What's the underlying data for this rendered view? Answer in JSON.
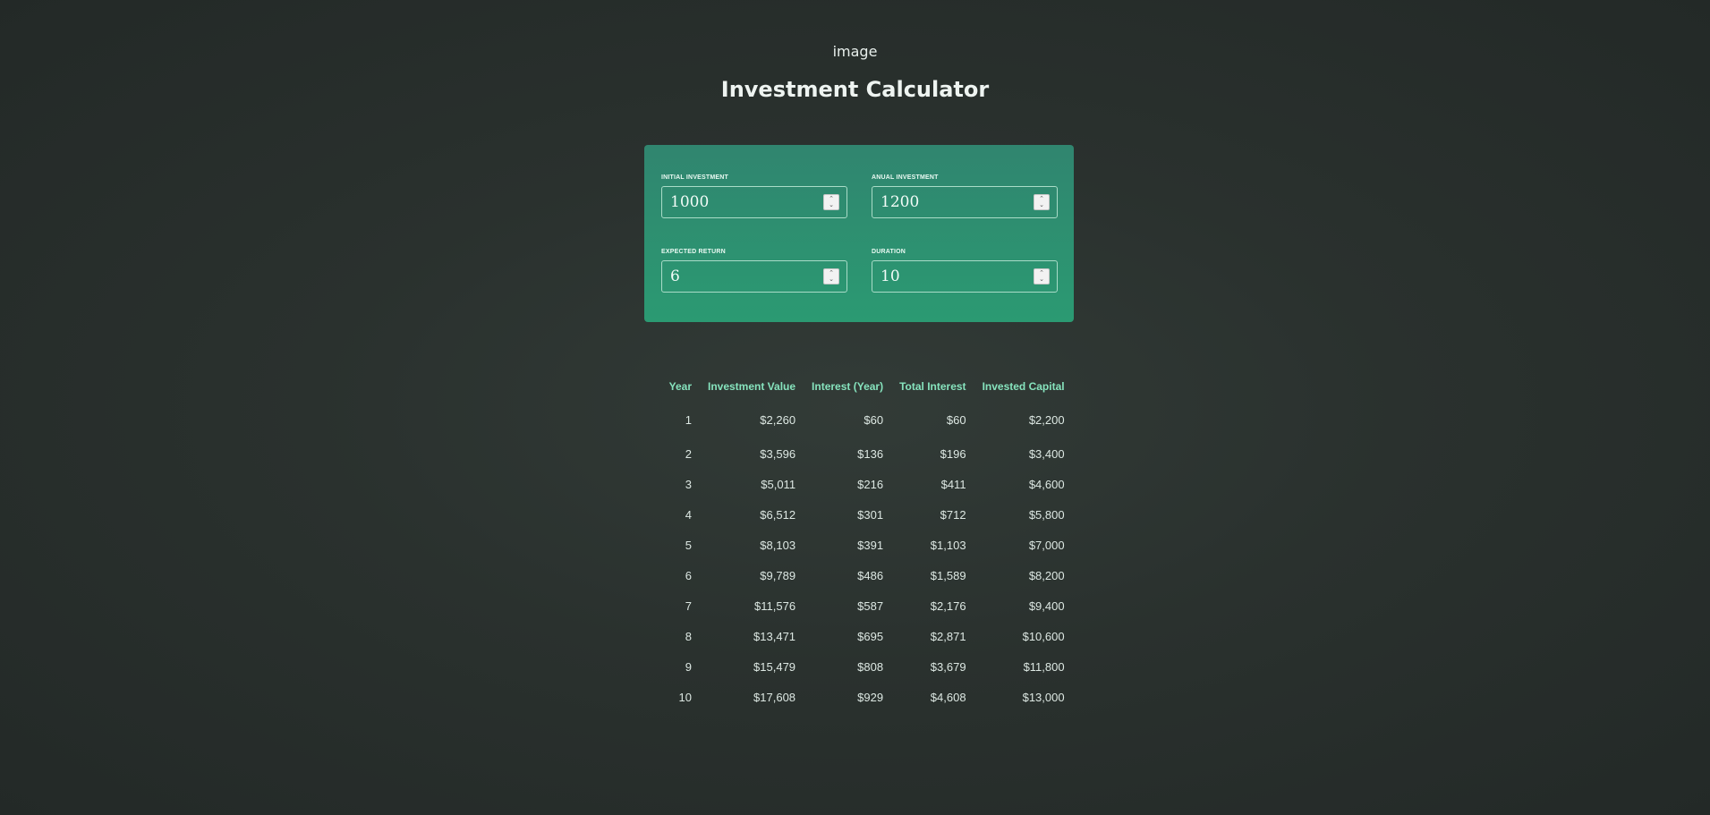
{
  "header": {
    "logo_alt_text": "image",
    "title": "Investment Calculator"
  },
  "inputs": [
    {
      "label": "INITIAL INVESTMENT",
      "value": "1000"
    },
    {
      "label": "ANUAL INVESTMENT",
      "value": "1200"
    },
    {
      "label": "EXPECTED RETURN",
      "value": "6"
    },
    {
      "label": "DURATION",
      "value": "10"
    }
  ],
  "colors": {
    "accent": "#2b9a72",
    "table_header": "#86e3bd",
    "background": "#2a312e"
  },
  "table": {
    "headers": [
      "Year",
      "Investment Value",
      "Interest (Year)",
      "Total Interest",
      "Invested Capital"
    ],
    "rows": [
      [
        "1",
        "$2,260",
        "$60",
        "$60",
        "$2,200"
      ],
      [
        "2",
        "$3,596",
        "$136",
        "$196",
        "$3,400"
      ],
      [
        "3",
        "$5,011",
        "$216",
        "$411",
        "$4,600"
      ],
      [
        "4",
        "$6,512",
        "$301",
        "$712",
        "$5,800"
      ],
      [
        "5",
        "$8,103",
        "$391",
        "$1,103",
        "$7,000"
      ],
      [
        "6",
        "$9,789",
        "$486",
        "$1,589",
        "$8,200"
      ],
      [
        "7",
        "$11,576",
        "$587",
        "$2,176",
        "$9,400"
      ],
      [
        "8",
        "$13,471",
        "$695",
        "$2,871",
        "$10,600"
      ],
      [
        "9",
        "$15,479",
        "$808",
        "$3,679",
        "$11,800"
      ],
      [
        "10",
        "$17,608",
        "$929",
        "$4,608",
        "$13,000"
      ]
    ]
  }
}
